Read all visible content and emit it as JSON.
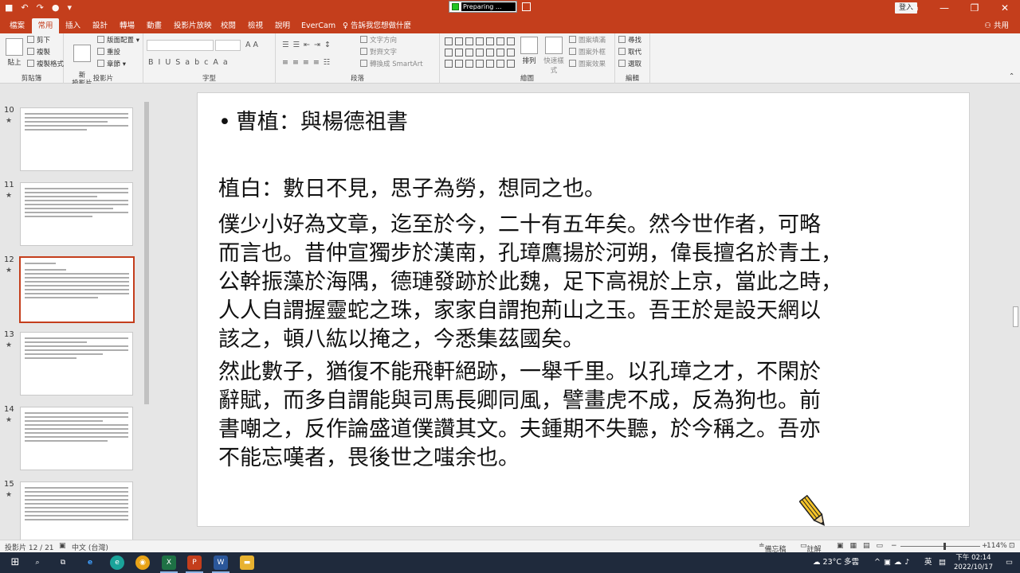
{
  "recorder": {
    "status": "Preparing ..."
  },
  "titlebar": {
    "signin": "登入"
  },
  "ribbon_tabs": [
    "檔案",
    "常用",
    "插入",
    "設計",
    "轉場",
    "動畫",
    "投影片放映",
    "校閱",
    "檢視",
    "說明",
    "EverCam"
  ],
  "active_tab": "常用",
  "tell_me": "告訴我您想做什麼",
  "share": "共用",
  "ribbon": {
    "clipboard": {
      "label": "剪貼簿",
      "paste": "貼上",
      "cut": "剪下",
      "copy": "複製",
      "format_painter": "複製格式"
    },
    "slides": {
      "label": "投影片",
      "new_slide": "新\n投影片",
      "layout": "版面配置",
      "reset": "重設",
      "section": "章節"
    },
    "font": {
      "label": "字型"
    },
    "paragraph": {
      "label": "段落",
      "text_direction": "文字方向",
      "align_text": "對齊文字",
      "smartart": "轉換成 SmartArt"
    },
    "drawing": {
      "label": "繪圖",
      "arrange": "排列",
      "quick_styles": "快速樣式",
      "shape_fill": "圖案填滿",
      "shape_outline": "圖案外框",
      "shape_effects": "圖案效果"
    },
    "editing": {
      "label": "編輯",
      "find": "尋找",
      "replace": "取代",
      "select": "選取"
    }
  },
  "thumbnails": [
    {
      "number": "10",
      "star": "★"
    },
    {
      "number": "11",
      "star": "★"
    },
    {
      "number": "12",
      "star": "★"
    },
    {
      "number": "13",
      "star": "★"
    },
    {
      "number": "14",
      "star": "★"
    },
    {
      "number": "15",
      "star": "★"
    }
  ],
  "active_slide_number": "12",
  "slide": {
    "title": "曹植：與楊德祖書",
    "paragraphs": [
      "植白：數日不見，思子為勞，想同之也。",
      "僕少小好為文章，迄至於今，二十有五年矣。然今世作者，可略\n而言也。昔仲宣獨步於漢南，孔璋鷹揚於河朔，偉長擅名於青土，\n公幹振藻於海隅，德璉發跡於此魏，足下高視於上京，當此之時，\n人人自謂握靈蛇之珠，家家自謂抱荊山之玉。吾王於是設天網以\n該之，頓八紘以掩之，今悉集茲國矣。",
      "然此數子，猶復不能飛軒絕跡，一舉千里。以孔璋之才，不閑於\n辭賦，而多自謂能與司馬長卿同風，譬畫虎不成，反為狗也。前\n書嘲之，反作論盛道僕讚其文。夫鍾期不失聽，於今稱之。吾亦\n不能忘嘆者，畏後世之嗤余也。"
    ]
  },
  "statusbar": {
    "slide_counter": "投影片 12 / 21",
    "language": "中文 (台灣)",
    "notes": "備忘稿",
    "comments": "註解",
    "zoom": "114%",
    "zoom_level": 0.55
  },
  "taskbar": {
    "weather": "23°C 多雲",
    "ime": "英",
    "time": "下午 02:14",
    "date": "2022/10/17"
  }
}
